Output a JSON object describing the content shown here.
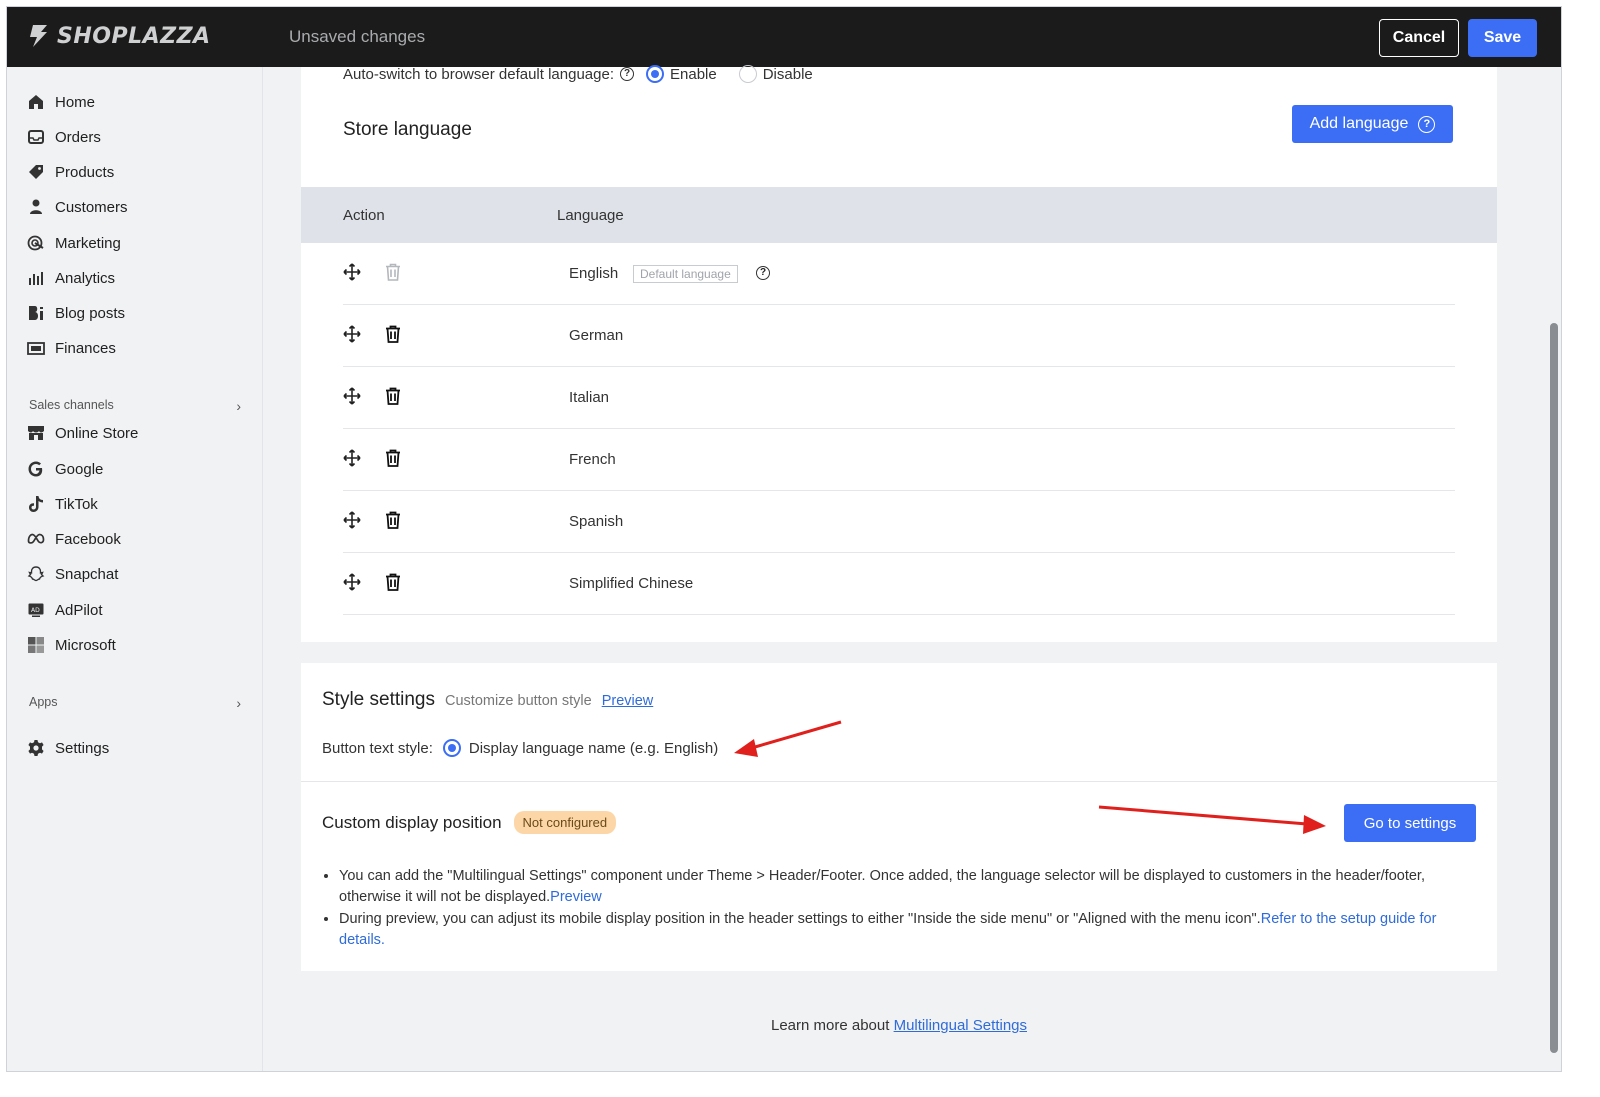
{
  "topbar": {
    "brand": "SHOPLAZZA",
    "status": "Unsaved changes",
    "cancel_label": "Cancel",
    "save_label": "Save"
  },
  "sidebar": {
    "items": [
      {
        "label": "Home",
        "icon": "home-icon"
      },
      {
        "label": "Orders",
        "icon": "inbox-icon"
      },
      {
        "label": "Products",
        "icon": "tag-icon"
      },
      {
        "label": "Customers",
        "icon": "person-icon"
      },
      {
        "label": "Marketing",
        "icon": "target-icon"
      },
      {
        "label": "Analytics",
        "icon": "bar-chart-icon"
      },
      {
        "label": "Blog posts",
        "icon": "blog-icon"
      },
      {
        "label": "Finances",
        "icon": "finance-icon"
      }
    ],
    "sales_channels_label": "Sales channels",
    "channels": [
      {
        "label": "Online Store",
        "icon": "store-icon"
      },
      {
        "label": "Google",
        "icon": "google-icon"
      },
      {
        "label": "TikTok",
        "icon": "tiktok-icon"
      },
      {
        "label": "Facebook",
        "icon": "meta-icon"
      },
      {
        "label": "Snapchat",
        "icon": "snapchat-icon"
      },
      {
        "label": "AdPilot",
        "icon": "adpilot-icon"
      },
      {
        "label": "Microsoft",
        "icon": "microsoft-icon"
      }
    ],
    "apps_label": "Apps",
    "settings_label": "Settings"
  },
  "auto_switch": {
    "label": "Auto-switch to browser default language:",
    "enable_label": "Enable",
    "disable_label": "Disable",
    "selected": "Enable"
  },
  "store_language": {
    "title": "Store language",
    "add_button": "Add language",
    "columns": [
      "Action",
      "Language"
    ],
    "languages": [
      "English",
      "German",
      "Italian",
      "French",
      "Spanish",
      "Simplified Chinese"
    ],
    "default_badge": "Default language"
  },
  "style_settings": {
    "title": "Style settings",
    "subtitle": "Customize button style",
    "preview_link": "Preview",
    "button_text_label": "Button text style:",
    "option_label": "Display language name (e.g. English)"
  },
  "custom_position": {
    "title": "Custom display position",
    "badge": "Not configured",
    "button": "Go to settings",
    "bullet1_text": "You can add the \"Multilingual Settings\" component under Theme > Header/Footer. Once added, the language selector will be displayed to customers in the header/footer, otherwise it will not be displayed.",
    "bullet1_link": "Preview",
    "bullet2_text": "During preview, you can adjust its mobile display position in the header settings to either \"Inside the side menu\" or \"Aligned with the menu icon\".",
    "bullet2_link": "Refer to the setup guide for details."
  },
  "footer": {
    "text": "Learn more about",
    "link": "Multilingual Settings"
  },
  "colors": {
    "accent": "#3b6ef5",
    "topbar": "#1b1b1b",
    "annotation_arrow": "#e0201c",
    "badge_bg": "#fcd6a6"
  }
}
